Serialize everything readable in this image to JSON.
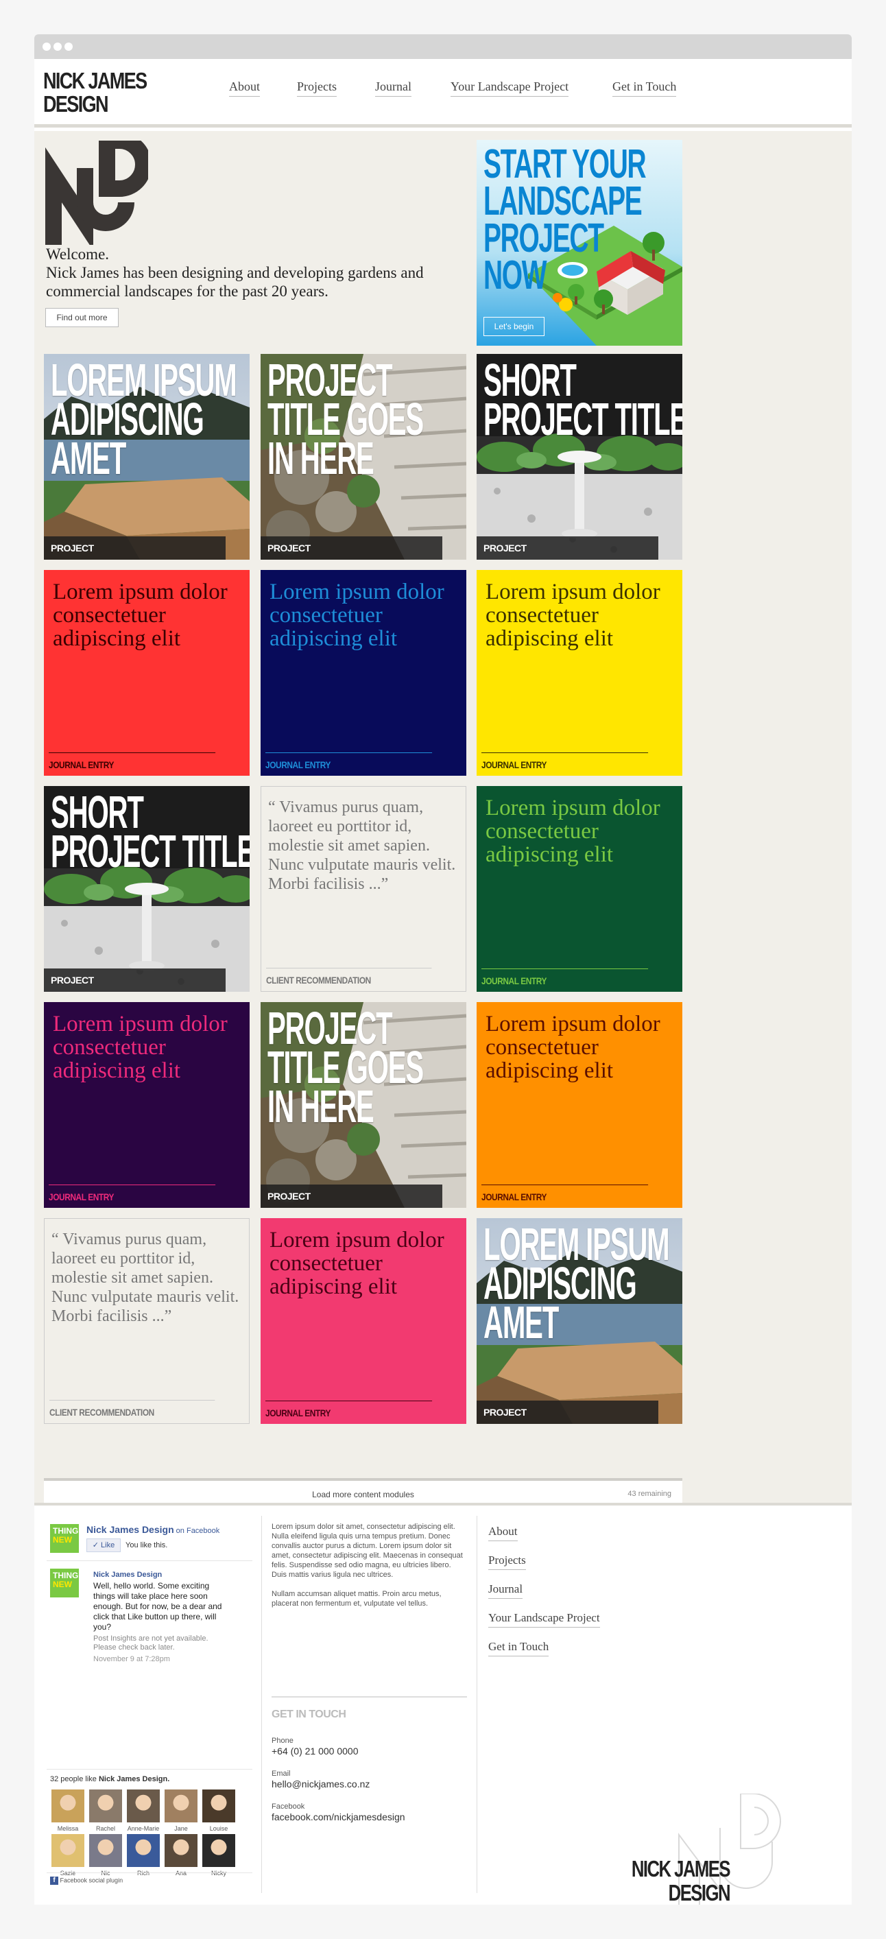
{
  "header": {
    "logo_line1": "NICK JAMES",
    "logo_line2": "DESIGN",
    "nav": [
      "About",
      "Projects",
      "Journal",
      "Your Landscape Project",
      "Get in Touch"
    ]
  },
  "hero": {
    "welcome": "Welcome.",
    "intro": "Nick James has been designing and developing gardens and commercial landscapes for the past 20 years.",
    "button": "Find out more"
  },
  "ad": {
    "lines": [
      "START YOUR",
      "LANDSCAPE",
      "PROJECT",
      "NOW"
    ],
    "button": "Let's begin"
  },
  "tiles": [
    {
      "kind": "photo",
      "scene": "deck",
      "title": [
        "LOREM IPSUM",
        "ADIPISCING",
        "AMET"
      ],
      "label": "PROJECT"
    },
    {
      "kind": "photo",
      "scene": "steps",
      "title": [
        "PROJECT",
        "TITLE GOES",
        "IN HERE"
      ],
      "label": "PROJECT"
    },
    {
      "kind": "photo",
      "scene": "garden",
      "title": [
        "SHORT",
        "PROJECT TITLE"
      ],
      "label": "PROJECT"
    },
    {
      "kind": "journal",
      "text": "Lorem ipsum dolor consectetuer adipiscing elit",
      "label": "JOURNAL ENTRY",
      "bg": "#ff3333",
      "fg": "#3a0000"
    },
    {
      "kind": "journal",
      "text": "Lorem ipsum dolor consectetuer adipiscing elit",
      "label": "JOURNAL ENTRY",
      "bg": "#080b5a",
      "fg": "#1e8ed8"
    },
    {
      "kind": "journal",
      "text": "Lorem ipsum dolor consectetuer adipiscing elit",
      "label": "JOURNAL ENTRY",
      "bg": "#ffe600",
      "fg": "#3a3000"
    },
    {
      "kind": "photo",
      "scene": "garden",
      "title": [
        "SHORT",
        "PROJECT TITLE"
      ],
      "label": "PROJECT"
    },
    {
      "kind": "quote",
      "text": "“ Vivamus purus quam, laoreet eu porttitor id, molestie sit amet sapien. Nunc vulputate mauris velit. Morbi facilisis ...”",
      "label": "CLIENT RECOMMENDATION"
    },
    {
      "kind": "journal",
      "text": "Lorem ipsum dolor consectetuer adipiscing elit",
      "label": "JOURNAL ENTRY",
      "bg": "#0a5530",
      "fg": "#7ac943"
    },
    {
      "kind": "journal",
      "text": "Lorem ipsum dolor consectetuer adipiscing elit",
      "label": "JOURNAL ENTRY",
      "bg": "#2a0542",
      "fg": "#ee2a7b"
    },
    {
      "kind": "photo",
      "scene": "steps",
      "title": [
        "PROJECT",
        "TITLE GOES",
        "IN HERE"
      ],
      "label": "PROJECT"
    },
    {
      "kind": "journal",
      "text": "Lorem ipsum dolor consectetuer adipiscing elit",
      "label": "JOURNAL ENTRY",
      "bg": "#ff9000",
      "fg": "#5a0e00"
    },
    {
      "kind": "quote",
      "text": "“ Vivamus purus quam, laoreet eu porttitor id, molestie sit amet sapien. Nunc vulputate mauris velit. Morbi facilisis ...”",
      "label": "CLIENT RECOMMENDATION"
    },
    {
      "kind": "journal",
      "text": "Lorem ipsum dolor consectetuer adipiscing elit",
      "label": "JOURNAL ENTRY",
      "bg": "#f23a70",
      "fg": "#4a0014"
    },
    {
      "kind": "photo",
      "scene": "deck",
      "title": [
        "LOREM IPSUM",
        "ADIPISCING",
        "AMET"
      ],
      "label": "PROJECT"
    }
  ],
  "loadmore": {
    "label": "Load more content modules",
    "remaining": "43 remaining"
  },
  "facebook": {
    "page": "Nick James Design",
    "on": " on Facebook",
    "like": "Like",
    "you_like": "You like this.",
    "post_author": "Nick James Design",
    "post_text": "Well, hello world. Some exciting things will take place here soon enough. But for now, be a dear and click that Like button up there, will you?",
    "post_note": "Post Insights are not yet available. Please check back later.",
    "post_time": "November 9 at 7:28pm",
    "fans_prefix": "32 people like ",
    "fans_page": "Nick James Design.",
    "fans": [
      "Melissa",
      "Rachel",
      "Anne-Marie",
      "Jane",
      "Louise",
      "Sazie",
      "Nic",
      "Rich",
      "Ana",
      "Nicky"
    ],
    "plugin": "Facebook social plugin",
    "thumb_line1": "THING",
    "thumb_line2": "NEW"
  },
  "footer": {
    "para1": "Lorem ipsum dolor sit amet, consectetur adipiscing elit. Nulla eleifend ligula quis urna tempus pretium. Donec convallis auctor purus a dictum. Lorem ipsum dolor sit amet, consectetur adipiscing elit. Maecenas in consequat felis. Suspendisse sed odio magna, eu ultricies libero. Duis mattis varius ligula nec ultrices.",
    "para2": "Nullam accumsan aliquet mattis. Proin arcu metus, placerat non fermentum et, vulputate vel tellus.",
    "contact_heading": "GET IN TOUCH",
    "phone_label": "Phone",
    "phone": "+64 (0) 21 000 0000",
    "email_label": "Email",
    "email": "hello@nickjames.co.nz",
    "fb_label": "Facebook",
    "fb": "facebook.com/nickjamesdesign",
    "links": [
      "About",
      "Projects",
      "Journal",
      "Your Landscape Project",
      "Get in Touch"
    ],
    "logo_line1": "NICK JAMES",
    "logo_line2": "DESIGN"
  }
}
